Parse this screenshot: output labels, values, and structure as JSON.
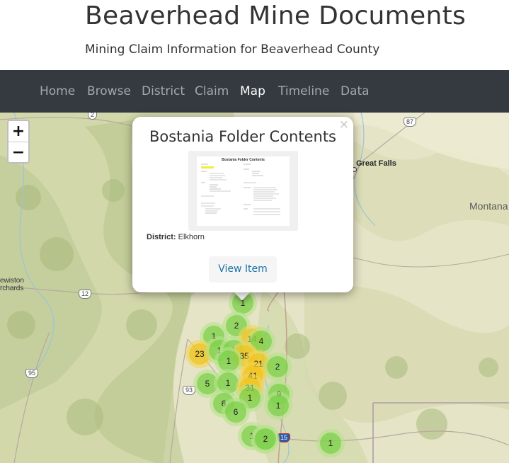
{
  "header": {
    "title": "Beaverhead Mine Documents",
    "subtitle": "Mining Claim Information for Beaverhead County"
  },
  "nav": {
    "items": [
      {
        "label": "Home",
        "active": false
      },
      {
        "label": "Browse",
        "active": false
      },
      {
        "label": "District",
        "active": false
      },
      {
        "label": "Claim",
        "active": false
      },
      {
        "label": "Map",
        "active": true
      },
      {
        "label": "Timeline",
        "active": false
      },
      {
        "label": "Data",
        "active": false
      }
    ]
  },
  "map": {
    "zoom_in": "+",
    "zoom_out": "−",
    "labels": {
      "great_falls": "Great Falls",
      "montana": "Montana",
      "lewiston": "ewiston",
      "orchards": "rchards"
    },
    "shields": {
      "us2": "2",
      "us87": "87",
      "us12": "12",
      "us95": "95",
      "us93": "93",
      "i15": "15"
    },
    "clusters": [
      {
        "count": "1",
        "tier": "small"
      },
      {
        "count": "2",
        "tier": "small"
      },
      {
        "count": "14",
        "tier": "medium"
      },
      {
        "count": "4",
        "tier": "small"
      },
      {
        "count": "1",
        "tier": "small"
      },
      {
        "count": "23",
        "tier": "medium"
      },
      {
        "count": "1",
        "tier": "small"
      },
      {
        "count": "1",
        "tier": "small"
      },
      {
        "count": "35",
        "tier": "medium"
      },
      {
        "count": "21",
        "tier": "medium"
      },
      {
        "count": "1",
        "tier": "small"
      },
      {
        "count": "2",
        "tier": "small"
      },
      {
        "count": "41",
        "tier": "medium"
      },
      {
        "count": "5",
        "tier": "small"
      },
      {
        "count": "1",
        "tier": "small"
      },
      {
        "count": "31",
        "tier": "medium"
      },
      {
        "count": "9",
        "tier": "small"
      },
      {
        "count": "1",
        "tier": "small"
      },
      {
        "count": "1",
        "tier": "small"
      },
      {
        "count": "6",
        "tier": "small"
      },
      {
        "count": "6",
        "tier": "small"
      },
      {
        "count": "1",
        "tier": "small"
      },
      {
        "count": "1",
        "tier": "small"
      },
      {
        "count": "2",
        "tier": "small"
      },
      {
        "count": "1",
        "tier": "small"
      }
    ]
  },
  "popup": {
    "title": "Bostania Folder Contents",
    "close": "×",
    "thumbnail_caption": "Bostania Folder Contents",
    "district_label": "District:",
    "district_value": "Elkhorn",
    "button": "View Item"
  },
  "colors": {
    "navbar": "#343a40",
    "cluster_small": "#6ecc39",
    "cluster_medium": "#f0c20c",
    "link": "#1a73a8"
  }
}
